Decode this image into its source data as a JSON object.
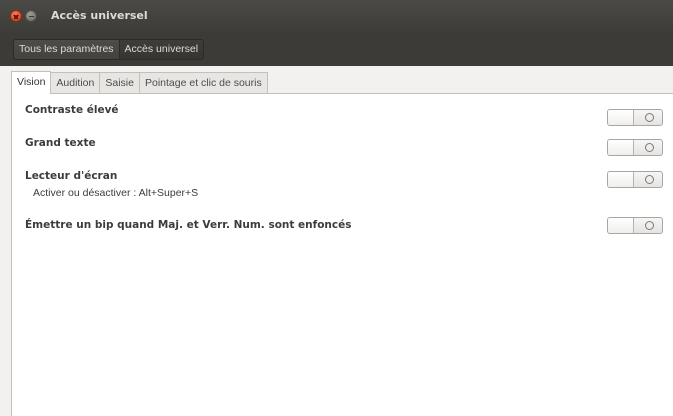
{
  "window": {
    "title": "Accès universel",
    "buttons": [
      "close-icon",
      "minimize-icon"
    ]
  },
  "breadcrumb": {
    "items": [
      {
        "label": "Tous les paramètres"
      },
      {
        "label": "Accès universel"
      }
    ]
  },
  "tabs": [
    {
      "label": "Vision",
      "selected": true
    },
    {
      "label": "Audition",
      "selected": false
    },
    {
      "label": "Saisie",
      "selected": false
    },
    {
      "label": "Pointage et clic de souris",
      "selected": false
    }
  ],
  "vision": {
    "rows": [
      {
        "label": "Contraste élevé",
        "state": "off"
      },
      {
        "label": "Grand texte",
        "state": "off"
      },
      {
        "label": "Lecteur d'écran",
        "shortcut": "Activer ou désactiver : Alt+Super+S",
        "state": "off"
      },
      {
        "label": "Émettre un bip quand Maj. et Verr. Num. sont enfoncés",
        "state": "off"
      }
    ]
  },
  "colors": {
    "titlebar": "#3d3c38",
    "close_button": "#e4502b",
    "page_background": "#ffffff"
  }
}
